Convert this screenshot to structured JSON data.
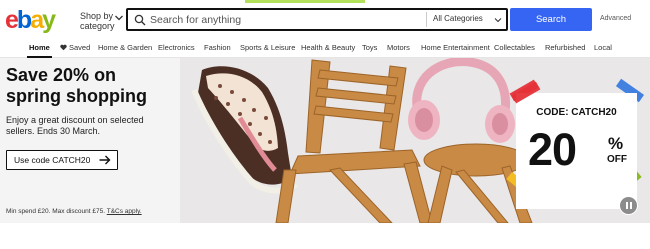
{
  "header": {
    "logo": {
      "letters": [
        "e",
        "b",
        "a",
        "y"
      ],
      "colors": [
        "#e53238",
        "#0064d2",
        "#f5af02",
        "#86b817"
      ]
    },
    "shop_by_category": "Shop by category",
    "search": {
      "placeholder": "Search for anything",
      "category_label": "All Categories",
      "button_label": "Search"
    },
    "advanced_label": "Advanced",
    "accent_color": "#3665f3"
  },
  "nav": {
    "items": [
      {
        "label": "Home",
        "active": true
      },
      {
        "label": "Saved",
        "icon": "heart-icon"
      },
      {
        "label": "Home & Garden"
      },
      {
        "label": "Electronics"
      },
      {
        "label": "Fashion"
      },
      {
        "label": "Sports & Leisure"
      },
      {
        "label": "Health & Beauty"
      },
      {
        "label": "Toys"
      },
      {
        "label": "Motors"
      },
      {
        "label": "Home Entertainment"
      },
      {
        "label": "Collectables"
      },
      {
        "label": "Refurbished"
      },
      {
        "label": "Local"
      }
    ]
  },
  "banner": {
    "headline": "Save 20% on spring shopping",
    "subtext": "Enjoy a great discount on selected sellers. Ends 30 March.",
    "cta_label": "Use code CATCH20",
    "fineprint": "Min spend £20. Max discount £75.",
    "fineprint_link": "T&Cs apply.",
    "promo": {
      "code": "CODE: CATCH20",
      "percent": "20",
      "percent_sign": "%",
      "off": "OFF"
    },
    "images": [
      "sneaker",
      "wooden-folding-chair",
      "pink-headphones",
      "wooden-round-stool"
    ]
  }
}
